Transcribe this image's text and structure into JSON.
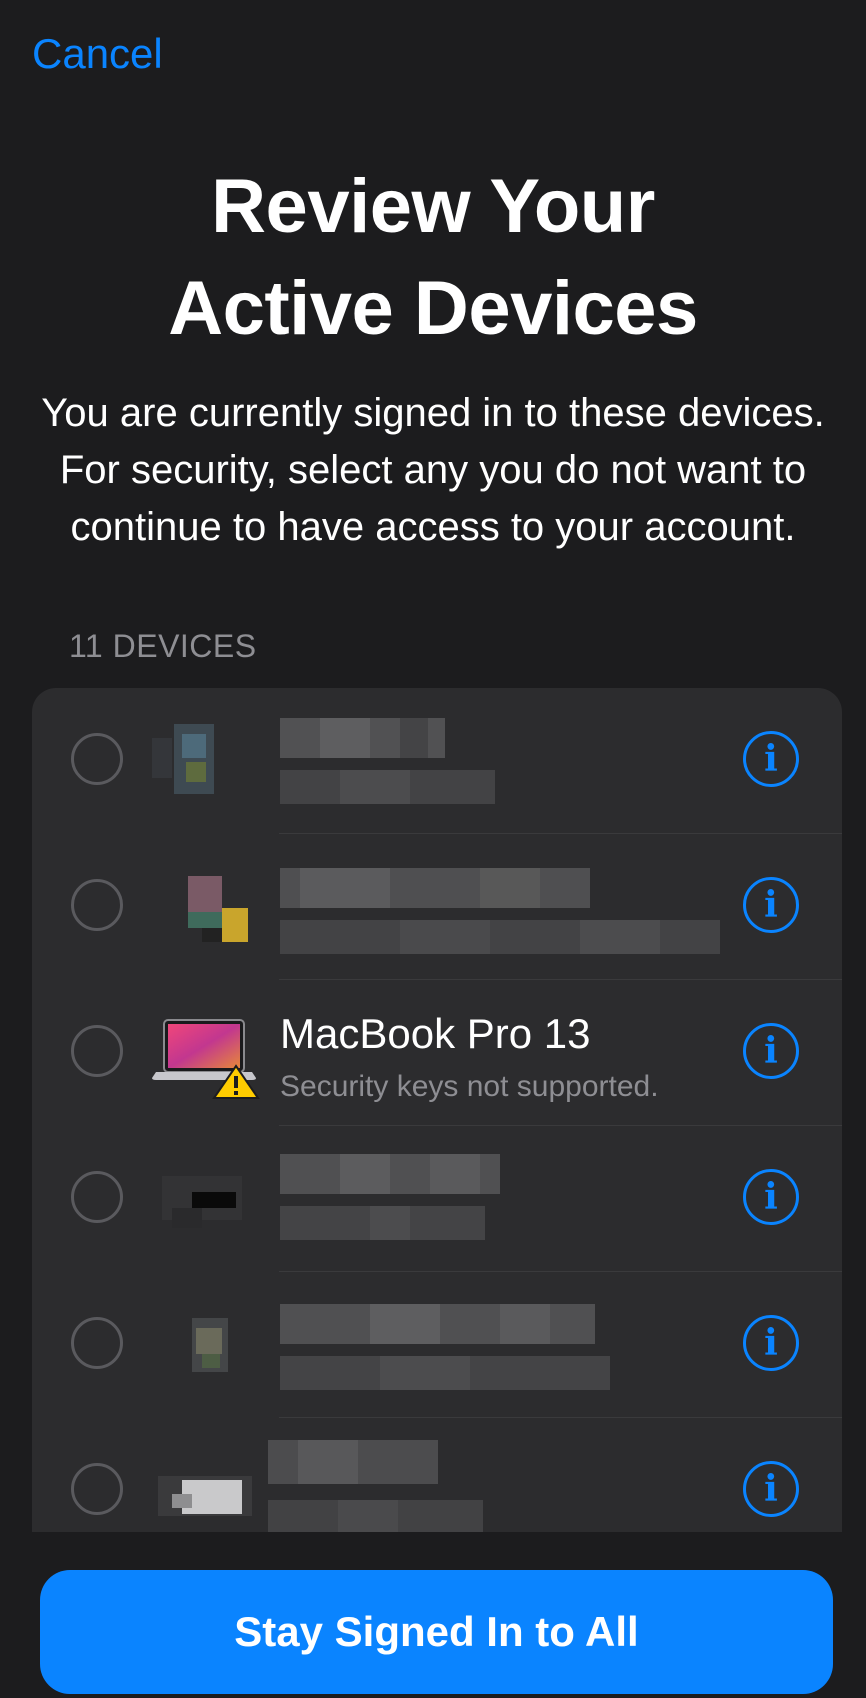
{
  "nav": {
    "cancel_label": "Cancel"
  },
  "header": {
    "title_line1": "Review Your",
    "title_line2": "Active Devices",
    "subtitle": "You are currently signed in to these devices. For security, select any you do not want to continue to have access to your account."
  },
  "devices": {
    "count_label": "11 DEVICES",
    "items": [
      {
        "name": "",
        "detail": "",
        "redacted": true,
        "selected": false
      },
      {
        "name": "",
        "detail": "",
        "redacted": true,
        "selected": false
      },
      {
        "name": "MacBook Pro 13",
        "detail": "Security keys not supported.",
        "redacted": false,
        "selected": false,
        "warning": true
      },
      {
        "name": "",
        "detail": "",
        "redacted": true,
        "selected": false
      },
      {
        "name": "",
        "detail": "",
        "redacted": true,
        "selected": false
      },
      {
        "name": "",
        "detail": "",
        "redacted": true,
        "selected": false
      }
    ],
    "info_glyph": "i"
  },
  "footer": {
    "primary_button_label": "Stay Signed In to All"
  },
  "colors": {
    "accent": "#0a84ff",
    "background": "#1c1c1e",
    "card": "#2c2c2e"
  },
  "icons": [
    "radio-unchecked-icon",
    "info-icon",
    "laptop-icon",
    "warning-icon"
  ]
}
